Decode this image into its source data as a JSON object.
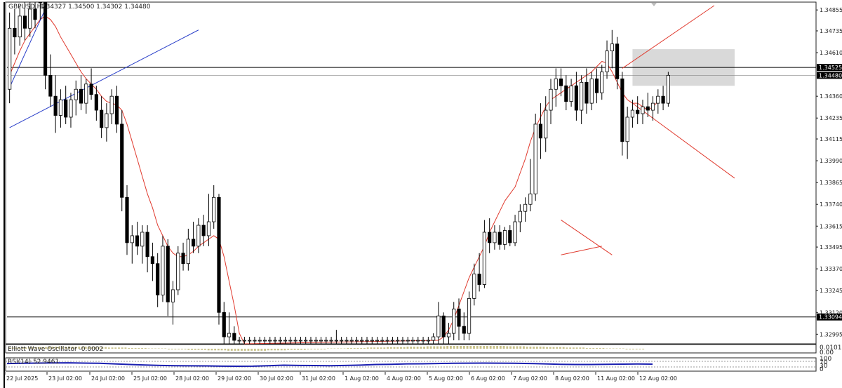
{
  "window": {
    "symbol_label": "GBPUSD,H2",
    "ohlc_label": "1.34327 1.34500 1.34302 1.34480"
  },
  "colors": {
    "background": "#ffffff",
    "candle": "#000000",
    "ma_line": "#e03a2e",
    "trendline_blue": "#2a3fc9",
    "trendline_red": "#e03a2e",
    "zone": "#d5d5d5",
    "rsi_line": "#1a1fb0",
    "ewo_bars": "#c9c28a",
    "left_border": "#000000"
  },
  "price_axis": {
    "labels": [
      "1.34855",
      "1.34735",
      "1.34610",
      "1.34525",
      "1.34480",
      "1.34360",
      "1.34235",
      "1.34115",
      "1.33990",
      "1.33865",
      "1.33740",
      "1.33615",
      "1.33495",
      "1.33370",
      "1.33245",
      "1.33120",
      "1.33094",
      "1.32995"
    ],
    "highlighted": [
      "1.34525",
      "1.34480",
      "1.33094"
    ]
  },
  "time_axis": {
    "labels": [
      "22 Jul 2025",
      "23 Jul 02:00",
      "24 Jul 02:00",
      "25 Jul 02:00",
      "28 Jul 02:00",
      "29 Jul 02:00",
      "30 Jul 02:00",
      "31 Jul 02:00",
      "1 Aug 02:00",
      "4 Aug 02:00",
      "5 Aug 02:00",
      "6 Aug 02:00",
      "7 Aug 02:00",
      "8 Aug 02:00",
      "11 Aug 02:00",
      "12 Aug 02:00"
    ]
  },
  "ewo_panel": {
    "label": "Elliott Wave Oscillator -0.0002",
    "axis_labels": [
      "0.0101",
      "0.00"
    ]
  },
  "rsi_panel": {
    "label": "RSI(14) 52.9461",
    "axis_labels": [
      "100",
      "70",
      "30",
      "0"
    ]
  },
  "chart_data": {
    "type": "candlestick",
    "ylim": [
      1.3294,
      1.349
    ],
    "horizontal_lines": [
      1.34525,
      1.33094
    ],
    "zone": {
      "from_bar": 122,
      "to_bar": 142,
      "top": 1.3463,
      "bottom": 1.3442
    },
    "candles": [
      {
        "o": 1.344,
        "h": 1.3484,
        "l": 1.3432,
        "c": 1.3475
      },
      {
        "o": 1.3475,
        "h": 1.3486,
        "l": 1.346,
        "c": 1.347
      },
      {
        "o": 1.347,
        "h": 1.3488,
        "l": 1.3465,
        "c": 1.3482
      },
      {
        "o": 1.3482,
        "h": 1.3492,
        "l": 1.3468,
        "c": 1.3475
      },
      {
        "o": 1.3475,
        "h": 1.349,
        "l": 1.347,
        "c": 1.3486
      },
      {
        "o": 1.3486,
        "h": 1.3495,
        "l": 1.3475,
        "c": 1.348
      },
      {
        "o": 1.35,
        "h": 1.3505,
        "l": 1.348,
        "c": 1.3492
      },
      {
        "o": 1.3492,
        "h": 1.35,
        "l": 1.344,
        "c": 1.3448
      },
      {
        "o": 1.3448,
        "h": 1.346,
        "l": 1.343,
        "c": 1.3436
      },
      {
        "o": 1.3436,
        "h": 1.3448,
        "l": 1.3415,
        "c": 1.3425
      },
      {
        "o": 1.3425,
        "h": 1.344,
        "l": 1.3418,
        "c": 1.3434
      },
      {
        "o": 1.3434,
        "h": 1.3442,
        "l": 1.342,
        "c": 1.3424
      },
      {
        "o": 1.3424,
        "h": 1.3438,
        "l": 1.3418,
        "c": 1.3434
      },
      {
        "o": 1.3434,
        "h": 1.3445,
        "l": 1.3425,
        "c": 1.344
      },
      {
        "o": 1.344,
        "h": 1.3448,
        "l": 1.3428,
        "c": 1.3432
      },
      {
        "o": 1.3432,
        "h": 1.3446,
        "l": 1.3426,
        "c": 1.3443
      },
      {
        "o": 1.3443,
        "h": 1.3452,
        "l": 1.3434,
        "c": 1.3437
      },
      {
        "o": 1.3437,
        "h": 1.3442,
        "l": 1.3422,
        "c": 1.3428
      },
      {
        "o": 1.3428,
        "h": 1.3436,
        "l": 1.3412,
        "c": 1.3418
      },
      {
        "o": 1.3418,
        "h": 1.3432,
        "l": 1.341,
        "c": 1.3426
      },
      {
        "o": 1.3426,
        "h": 1.344,
        "l": 1.342,
        "c": 1.3436
      },
      {
        "o": 1.3436,
        "h": 1.3442,
        "l": 1.3415,
        "c": 1.342
      },
      {
        "o": 1.342,
        "h": 1.3428,
        "l": 1.337,
        "c": 1.3378
      },
      {
        "o": 1.3378,
        "h": 1.3385,
        "l": 1.3345,
        "c": 1.3352
      },
      {
        "o": 1.3352,
        "h": 1.3362,
        "l": 1.334,
        "c": 1.3356
      },
      {
        "o": 1.3356,
        "h": 1.3364,
        "l": 1.3345,
        "c": 1.335
      },
      {
        "o": 1.335,
        "h": 1.3362,
        "l": 1.334,
        "c": 1.3358
      },
      {
        "o": 1.3358,
        "h": 1.3362,
        "l": 1.3335,
        "c": 1.3344
      },
      {
        "o": 1.3344,
        "h": 1.3352,
        "l": 1.333,
        "c": 1.334
      },
      {
        "o": 1.334,
        "h": 1.3346,
        "l": 1.3315,
        "c": 1.3322
      },
      {
        "o": 1.3322,
        "h": 1.3356,
        "l": 1.3318,
        "c": 1.335
      },
      {
        "o": 1.335,
        "h": 1.3354,
        "l": 1.331,
        "c": 1.3318
      },
      {
        "o": 1.3318,
        "h": 1.333,
        "l": 1.3305,
        "c": 1.3325
      },
      {
        "o": 1.3325,
        "h": 1.335,
        "l": 1.3322,
        "c": 1.3346
      },
      {
        "o": 1.3346,
        "h": 1.3352,
        "l": 1.3336,
        "c": 1.334
      },
      {
        "o": 1.334,
        "h": 1.336,
        "l": 1.3336,
        "c": 1.3354
      },
      {
        "o": 1.3354,
        "h": 1.3364,
        "l": 1.3346,
        "c": 1.335
      },
      {
        "o": 1.335,
        "h": 1.3366,
        "l": 1.3346,
        "c": 1.3362
      },
      {
        "o": 1.3362,
        "h": 1.3368,
        "l": 1.335,
        "c": 1.3356
      },
      {
        "o": 1.3356,
        "h": 1.338,
        "l": 1.335,
        "c": 1.3364
      },
      {
        "o": 1.3364,
        "h": 1.3385,
        "l": 1.336,
        "c": 1.3378
      },
      {
        "o": 1.3378,
        "h": 1.338,
        "l": 1.3305,
        "c": 1.3312
      },
      {
        "o": 1.3312,
        "h": 1.3318,
        "l": 1.3294,
        "c": 1.3298
      },
      {
        "o": 1.3298,
        "h": 1.3312,
        "l": 1.3294,
        "c": 1.33
      },
      {
        "o": 1.33,
        "h": 1.3304,
        "l": 1.3294,
        "c": 1.3296
      },
      {
        "o": 1.3296,
        "h": 1.3298,
        "l": 1.3294,
        "c": 1.3296
      },
      {
        "o": 1.3296,
        "h": 1.3298,
        "l": 1.3294,
        "c": 1.3296
      },
      {
        "o": 1.3296,
        "h": 1.3298,
        "l": 1.3294,
        "c": 1.3296
      },
      {
        "o": 1.3296,
        "h": 1.3298,
        "l": 1.3294,
        "c": 1.3296
      },
      {
        "o": 1.3296,
        "h": 1.3298,
        "l": 1.3294,
        "c": 1.3296
      },
      {
        "o": 1.3296,
        "h": 1.3298,
        "l": 1.3294,
        "c": 1.3296
      },
      {
        "o": 1.3296,
        "h": 1.3298,
        "l": 1.3294,
        "c": 1.3296
      },
      {
        "o": 1.3296,
        "h": 1.3298,
        "l": 1.3294,
        "c": 1.3296
      },
      {
        "o": 1.3296,
        "h": 1.3298,
        "l": 1.3294,
        "c": 1.3296
      },
      {
        "o": 1.3296,
        "h": 1.3298,
        "l": 1.3294,
        "c": 1.3296
      },
      {
        "o": 1.3296,
        "h": 1.3298,
        "l": 1.3294,
        "c": 1.3296
      },
      {
        "o": 1.3296,
        "h": 1.3298,
        "l": 1.3294,
        "c": 1.3296
      },
      {
        "o": 1.3296,
        "h": 1.3298,
        "l": 1.3294,
        "c": 1.3296
      },
      {
        "o": 1.3296,
        "h": 1.3298,
        "l": 1.3294,
        "c": 1.3296
      },
      {
        "o": 1.3296,
        "h": 1.3298,
        "l": 1.3294,
        "c": 1.3296
      },
      {
        "o": 1.3296,
        "h": 1.3298,
        "l": 1.3294,
        "c": 1.3296
      },
      {
        "o": 1.3296,
        "h": 1.3298,
        "l": 1.3294,
        "c": 1.3296
      },
      {
        "o": 1.3296,
        "h": 1.3298,
        "l": 1.3294,
        "c": 1.3296
      },
      {
        "o": 1.3296,
        "h": 1.3298,
        "l": 1.3294,
        "c": 1.3296
      },
      {
        "o": 1.3296,
        "h": 1.3302,
        "l": 1.3294,
        "c": 1.3296
      },
      {
        "o": 1.3296,
        "h": 1.3298,
        "l": 1.3294,
        "c": 1.3296
      },
      {
        "o": 1.3296,
        "h": 1.3298,
        "l": 1.3294,
        "c": 1.3296
      },
      {
        "o": 1.3296,
        "h": 1.3298,
        "l": 1.3294,
        "c": 1.3296
      },
      {
        "o": 1.3296,
        "h": 1.3298,
        "l": 1.3294,
        "c": 1.3296
      },
      {
        "o": 1.3296,
        "h": 1.3298,
        "l": 1.3294,
        "c": 1.3296
      },
      {
        "o": 1.3296,
        "h": 1.3298,
        "l": 1.3294,
        "c": 1.3296
      },
      {
        "o": 1.3296,
        "h": 1.3298,
        "l": 1.3294,
        "c": 1.3296
      },
      {
        "o": 1.3296,
        "h": 1.3298,
        "l": 1.3294,
        "c": 1.3296
      },
      {
        "o": 1.3296,
        "h": 1.3298,
        "l": 1.3294,
        "c": 1.3296
      },
      {
        "o": 1.3296,
        "h": 1.3298,
        "l": 1.3294,
        "c": 1.3296
      },
      {
        "o": 1.3296,
        "h": 1.3298,
        "l": 1.3294,
        "c": 1.3296
      },
      {
        "o": 1.3296,
        "h": 1.3298,
        "l": 1.3294,
        "c": 1.3296
      },
      {
        "o": 1.3296,
        "h": 1.3298,
        "l": 1.3294,
        "c": 1.3296
      },
      {
        "o": 1.3296,
        "h": 1.3298,
        "l": 1.3294,
        "c": 1.3296
      },
      {
        "o": 1.3296,
        "h": 1.3298,
        "l": 1.3294,
        "c": 1.3296
      },
      {
        "o": 1.3296,
        "h": 1.3298,
        "l": 1.3294,
        "c": 1.3296
      },
      {
        "o": 1.3296,
        "h": 1.3298,
        "l": 1.3294,
        "c": 1.3296
      },
      {
        "o": 1.3296,
        "h": 1.3298,
        "l": 1.3294,
        "c": 1.3296
      },
      {
        "o": 1.3296,
        "h": 1.33,
        "l": 1.3294,
        "c": 1.3298
      },
      {
        "o": 1.3298,
        "h": 1.3318,
        "l": 1.3294,
        "c": 1.331
      },
      {
        "o": 1.331,
        "h": 1.3312,
        "l": 1.3294,
        "c": 1.3298
      },
      {
        "o": 1.3298,
        "h": 1.3306,
        "l": 1.3294,
        "c": 1.33
      },
      {
        "o": 1.33,
        "h": 1.3318,
        "l": 1.3296,
        "c": 1.3314
      },
      {
        "o": 1.3314,
        "h": 1.332,
        "l": 1.3296,
        "c": 1.3304
      },
      {
        "o": 1.3304,
        "h": 1.3312,
        "l": 1.3296,
        "c": 1.33
      },
      {
        "o": 1.33,
        "h": 1.3324,
        "l": 1.3296,
        "c": 1.332
      },
      {
        "o": 1.332,
        "h": 1.334,
        "l": 1.3316,
        "c": 1.3334
      },
      {
        "o": 1.3334,
        "h": 1.3346,
        "l": 1.3324,
        "c": 1.3328
      },
      {
        "o": 1.3328,
        "h": 1.3365,
        "l": 1.3326,
        "c": 1.3358
      },
      {
        "o": 1.3358,
        "h": 1.3366,
        "l": 1.3346,
        "c": 1.3352
      },
      {
        "o": 1.3352,
        "h": 1.3362,
        "l": 1.3348,
        "c": 1.3358
      },
      {
        "o": 1.3358,
        "h": 1.3362,
        "l": 1.3348,
        "c": 1.3351
      },
      {
        "o": 1.3351,
        "h": 1.3361,
        "l": 1.3348,
        "c": 1.3359
      },
      {
        "o": 1.3359,
        "h": 1.3362,
        "l": 1.335,
        "c": 1.3352
      },
      {
        "o": 1.3352,
        "h": 1.3368,
        "l": 1.335,
        "c": 1.3364
      },
      {
        "o": 1.3364,
        "h": 1.3374,
        "l": 1.3358,
        "c": 1.337
      },
      {
        "o": 1.337,
        "h": 1.3378,
        "l": 1.3364,
        "c": 1.3374
      },
      {
        "o": 1.3374,
        "h": 1.34,
        "l": 1.337,
        "c": 1.338
      },
      {
        "o": 1.338,
        "h": 1.3426,
        "l": 1.3376,
        "c": 1.342
      },
      {
        "o": 1.342,
        "h": 1.3432,
        "l": 1.34,
        "c": 1.3412
      },
      {
        "o": 1.3412,
        "h": 1.3436,
        "l": 1.3404,
        "c": 1.3428
      },
      {
        "o": 1.3428,
        "h": 1.3446,
        "l": 1.342,
        "c": 1.344
      },
      {
        "o": 1.344,
        "h": 1.3452,
        "l": 1.343,
        "c": 1.3446
      },
      {
        "o": 1.3446,
        "h": 1.3452,
        "l": 1.3436,
        "c": 1.3442
      },
      {
        "o": 1.3442,
        "h": 1.3448,
        "l": 1.3428,
        "c": 1.3433
      },
      {
        "o": 1.3433,
        "h": 1.3446,
        "l": 1.343,
        "c": 1.3442
      },
      {
        "o": 1.3442,
        "h": 1.345,
        "l": 1.3422,
        "c": 1.3428
      },
      {
        "o": 1.3428,
        "h": 1.3448,
        "l": 1.342,
        "c": 1.3444
      },
      {
        "o": 1.3444,
        "h": 1.3452,
        "l": 1.3426,
        "c": 1.3432
      },
      {
        "o": 1.3432,
        "h": 1.345,
        "l": 1.3428,
        "c": 1.3446
      },
      {
        "o": 1.3446,
        "h": 1.3452,
        "l": 1.3432,
        "c": 1.3438
      },
      {
        "o": 1.3438,
        "h": 1.3454,
        "l": 1.3434,
        "c": 1.345
      },
      {
        "o": 1.345,
        "h": 1.3468,
        "l": 1.3446,
        "c": 1.3462
      },
      {
        "o": 1.3462,
        "h": 1.3474,
        "l": 1.3452,
        "c": 1.3466
      },
      {
        "o": 1.3466,
        "h": 1.347,
        "l": 1.344,
        "c": 1.3446
      },
      {
        "o": 1.3446,
        "h": 1.345,
        "l": 1.3402,
        "c": 1.341
      },
      {
        "o": 1.341,
        "h": 1.343,
        "l": 1.34,
        "c": 1.3424
      },
      {
        "o": 1.3424,
        "h": 1.3434,
        "l": 1.3418,
        "c": 1.3428
      },
      {
        "o": 1.3428,
        "h": 1.3436,
        "l": 1.342,
        "c": 1.3426
      },
      {
        "o": 1.3426,
        "h": 1.3434,
        "l": 1.342,
        "c": 1.343
      },
      {
        "o": 1.343,
        "h": 1.3438,
        "l": 1.3424,
        "c": 1.3428
      },
      {
        "o": 1.3428,
        "h": 1.3436,
        "l": 1.3422,
        "c": 1.3432
      },
      {
        "o": 1.3432,
        "h": 1.344,
        "l": 1.3426,
        "c": 1.3436
      },
      {
        "o": 1.3436,
        "h": 1.3442,
        "l": 1.3428,
        "c": 1.3432
      },
      {
        "o": 1.3432,
        "h": 1.345,
        "l": 1.343,
        "c": 1.3448
      }
    ],
    "moving_average": {
      "name": "MA",
      "values": [
        1.3448,
        1.3455,
        1.3462,
        1.3468,
        1.3472,
        1.3476,
        1.348,
        1.3482,
        1.348,
        1.3476,
        1.347,
        1.3465,
        1.346,
        1.3455,
        1.345,
        1.3446,
        1.3443,
        1.344,
        1.3436,
        1.3433,
        1.3432,
        1.3431,
        1.3428,
        1.342,
        1.341,
        1.34,
        1.339,
        1.338,
        1.3372,
        1.3362,
        1.3356,
        1.335,
        1.3346,
        1.3344,
        1.3344,
        1.3345,
        1.3347,
        1.335,
        1.3352,
        1.3354,
        1.3356,
        1.3354,
        1.3344,
        1.333,
        1.3316,
        1.33,
        1.329,
        null,
        null,
        null,
        null,
        null,
        null,
        null,
        null,
        null,
        null,
        null,
        null,
        null,
        null,
        null,
        null,
        null,
        null,
        null,
        null,
        null,
        null,
        null,
        null,
        null,
        null,
        null,
        null,
        null,
        null,
        null,
        null,
        null,
        null,
        null,
        null,
        null,
        1.3296,
        1.3298,
        1.3302,
        1.3308,
        1.3316,
        1.3324,
        1.3332,
        1.3338,
        1.3344,
        1.335,
        1.3358,
        1.3364,
        1.337,
        1.3376,
        1.338,
        1.3384,
        1.3392,
        1.34,
        1.341,
        1.3418,
        1.3424,
        1.343,
        1.3434,
        1.3436,
        1.3438,
        1.344,
        1.3442,
        1.3444,
        1.3446,
        1.3448,
        1.345,
        1.3453,
        1.3456,
        1.3455,
        1.345,
        1.3444,
        1.3438,
        1.3434,
        1.3432,
        1.3432,
        1.343,
        1.3428,
        1.343,
        1.3433
      ]
    },
    "trendlines": [
      {
        "color": "blue",
        "from": {
          "bar": 0,
          "price": 1.3418
        },
        "to": {
          "bar": 37,
          "price": 1.3474
        }
      },
      {
        "color": "blue",
        "from": {
          "bar": 0,
          "price": 1.3441
        },
        "to": {
          "bar": 7,
          "price": 1.3486
        }
      },
      {
        "color": "red",
        "from": {
          "bar": 120,
          "price": 1.3452
        },
        "to": {
          "bar": 138,
          "price": 1.3488
        }
      },
      {
        "color": "red",
        "from": {
          "bar": 122,
          "price": 1.3432
        },
        "to": {
          "bar": 142,
          "price": 1.3389
        }
      },
      {
        "color": "red",
        "from": {
          "bar": 108,
          "price": 1.3365
        },
        "to": {
          "bar": 118,
          "price": 1.3345
        }
      },
      {
        "color": "red",
        "from": {
          "bar": 108,
          "price": 1.3345
        },
        "to": {
          "bar": 116,
          "price": 1.335
        }
      }
    ],
    "ewo_values": [
      0.0002,
      0.0003,
      0.0004,
      0.0004,
      0.0003,
      0.0002,
      0.0001,
      0.0,
      -0.0001,
      -0.0002,
      -0.0003,
      -0.0004,
      -0.0004,
      -0.0003,
      -0.0002,
      -0.0001,
      0.0,
      0.0001,
      0.0002,
      0.0003,
      0.0004,
      0.0005,
      0.0006,
      0.0007,
      0.0006,
      0.0005,
      0.0004,
      0.0003,
      0.0002,
      0.0001,
      0.0,
      -0.0001
    ],
    "rsi_values": [
      58,
      60,
      62,
      63,
      64,
      62,
      60,
      55,
      50,
      46,
      42,
      40,
      39,
      38,
      36,
      35,
      36,
      40,
      44,
      42,
      41,
      40,
      42,
      45,
      50,
      52,
      55,
      56,
      58,
      60,
      61,
      62,
      61,
      60,
      58,
      55,
      52,
      50,
      50,
      52,
      53,
      54,
      53
    ]
  }
}
